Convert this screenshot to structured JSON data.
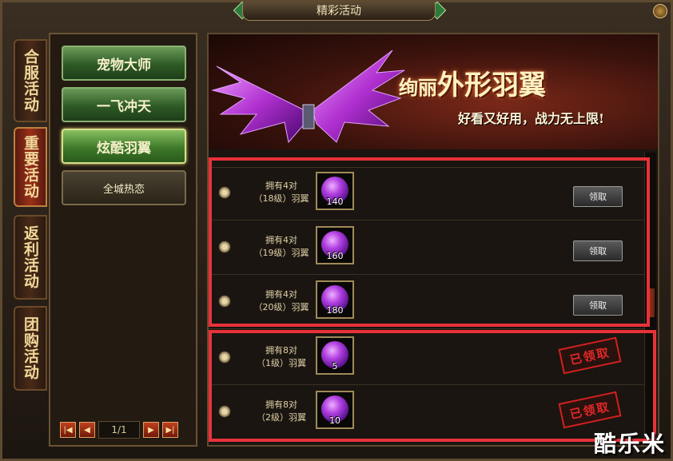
{
  "window": {
    "title": "精彩活动"
  },
  "categories": [
    {
      "label": "合服活动"
    },
    {
      "label": "重要活动"
    },
    {
      "label": "返利活动"
    },
    {
      "label": "团购活动"
    }
  ],
  "sub_items": [
    {
      "label": "宠物大师"
    },
    {
      "label": "一飞冲天"
    },
    {
      "label": "炫酷羽翼"
    },
    {
      "label": "全城热恋"
    }
  ],
  "pager": {
    "indicator": "1/1"
  },
  "banner": {
    "title_small": "绚丽",
    "title_big": "外形羽翼",
    "subtitle": "好看又好用，战力无上限!"
  },
  "rows": [
    {
      "line1": "拥有4对",
      "line2": "（18级）羽翼",
      "count": "140",
      "action": "领取"
    },
    {
      "line1": "拥有4对",
      "line2": "（19级）羽翼",
      "count": "160",
      "action": "领取"
    },
    {
      "line1": "拥有4对",
      "line2": "（20级）羽翼",
      "count": "180",
      "action": "领取"
    },
    {
      "line1": "拥有8对",
      "line2": "（1级）羽翼",
      "count": "5",
      "stamp": "已领取"
    },
    {
      "line1": "拥有8对",
      "line2": "（2级）羽翼",
      "count": "10",
      "stamp": "已领取"
    }
  ],
  "watermark": "酷乐米",
  "colors": {
    "highlight": "#e8323a",
    "accent_green": "#3e7a2a",
    "gem_purple": "#b040e0"
  }
}
